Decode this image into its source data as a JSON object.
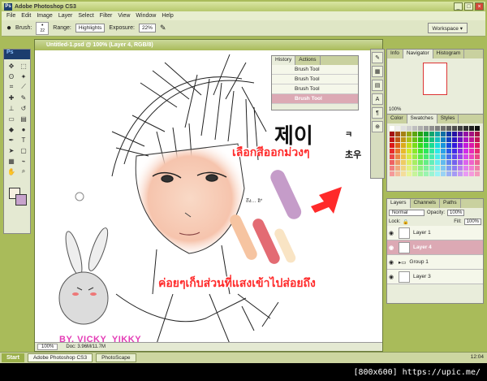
{
  "window": {
    "app_badge": "Ps",
    "title": "Adobe Photoshop CS3"
  },
  "menu": [
    "File",
    "Edit",
    "Image",
    "Layer",
    "Select",
    "Filter",
    "View",
    "Window",
    "Help"
  ],
  "options": {
    "brush_label": "Brush:",
    "brush_size": "22",
    "range_label": "Range:",
    "range_value": "Highlights",
    "exposure_label": "Exposure:",
    "exposure_value": "22%",
    "workspace_label": "Workspace"
  },
  "toolbox": {
    "logo": "Ps",
    "fg_color": "#f6eee0",
    "bg_color": "#c7a3cc"
  },
  "document": {
    "title": "Untitled-1.psd @ 100% (Layer 4, RGB/8)",
    "zoom": "100%",
    "doc_info": "Doc: 3.96M/11.7M",
    "hangul_line1": "제이",
    "hangul_small1": "ㅋ",
    "hangul_small2": "초우",
    "thai_top": "เลือกสีออกม่วงๆ",
    "thai_bottom": "ค่อยๆเก็บส่วนที่แสงเข้าไปส่อยถึง",
    "byline": "BY, VICKY_YIKKY",
    "signature": "ถึง… ฮิ*",
    "accent_red": "#ff2a2a"
  },
  "history": {
    "tabs": [
      "History",
      "Actions"
    ],
    "items": [
      "Brush Tool",
      "Brush Tool",
      "Brush Tool",
      "Brush Tool"
    ]
  },
  "navigator": {
    "tabs": [
      "Info",
      "Navigator",
      "Histogram"
    ],
    "zoom": "100%"
  },
  "swatches": {
    "tabs": [
      "Color",
      "Swatches",
      "Styles"
    ]
  },
  "layers": {
    "tabs": [
      "Layers",
      "Channels",
      "Paths"
    ],
    "blend_mode": "Normal",
    "opacity_label": "Opacity:",
    "opacity": "100%",
    "lock_label": "Lock:",
    "fill_label": "Fill:",
    "fill": "100%",
    "items": [
      "Layer 1",
      "Layer 4",
      "Group 1",
      "Layer 3"
    ]
  },
  "taskbar": {
    "start": "Start",
    "tasks": [
      "Adobe Photoshop CS3",
      "PhotoScape"
    ],
    "clock": "12:04"
  },
  "watermark": "[800x600] https://upic.me/"
}
